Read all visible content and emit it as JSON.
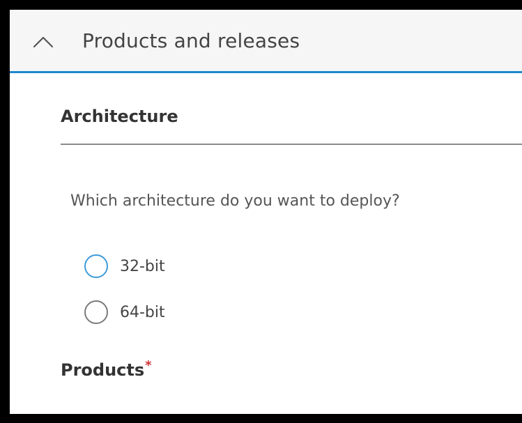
{
  "section": {
    "title": "Products and releases",
    "expanded": true,
    "icon": "chevron-up-icon",
    "accent_color": "#1e87cd"
  },
  "architecture": {
    "heading": "Architecture",
    "question": "Which architecture do you want to deploy?",
    "options": [
      {
        "label": "32-bit",
        "selected": false
      },
      {
        "label": "64-bit",
        "selected": false
      }
    ]
  },
  "products": {
    "label": "Products",
    "required_marker": "*",
    "required_color": "#d13438"
  }
}
